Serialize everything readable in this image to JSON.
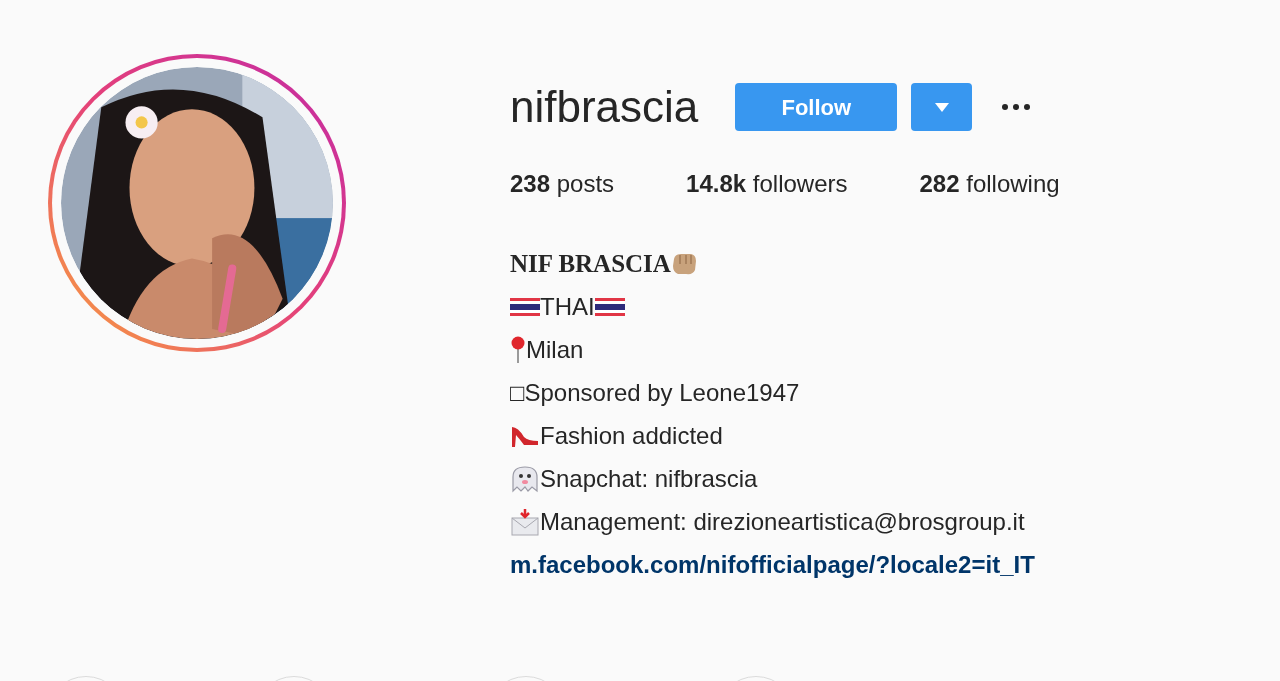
{
  "profile": {
    "username": "nifbrascia",
    "buttons": [
      {
        "kind": "follow",
        "label": "Follow"
      },
      {
        "kind": "dropdown"
      },
      {
        "kind": "more"
      }
    ],
    "stats": [
      {
        "count": "238",
        "label": "posts"
      },
      {
        "count": "14.8k",
        "label": "followers"
      },
      {
        "count": "282",
        "label": "following"
      }
    ],
    "bio": [
      {
        "kind": "name",
        "text": "NIF BRASCIA"
      },
      {
        "kind": "flag",
        "text": "THAI"
      },
      {
        "kind": "pin",
        "text": "Milan"
      },
      {
        "kind": "plain",
        "text": "□Sponsored by Leone1947"
      },
      {
        "kind": "heel",
        "text": "Fashion addicted"
      },
      {
        "kind": "ghost",
        "text": "Snapchat: nifbrascia"
      },
      {
        "kind": "mail",
        "text": "Management: direzioneartistica@brosgroup.it"
      },
      {
        "kind": "link",
        "text": "m.facebook.com/nifofficialpage/?locale2=it_IT"
      }
    ]
  }
}
